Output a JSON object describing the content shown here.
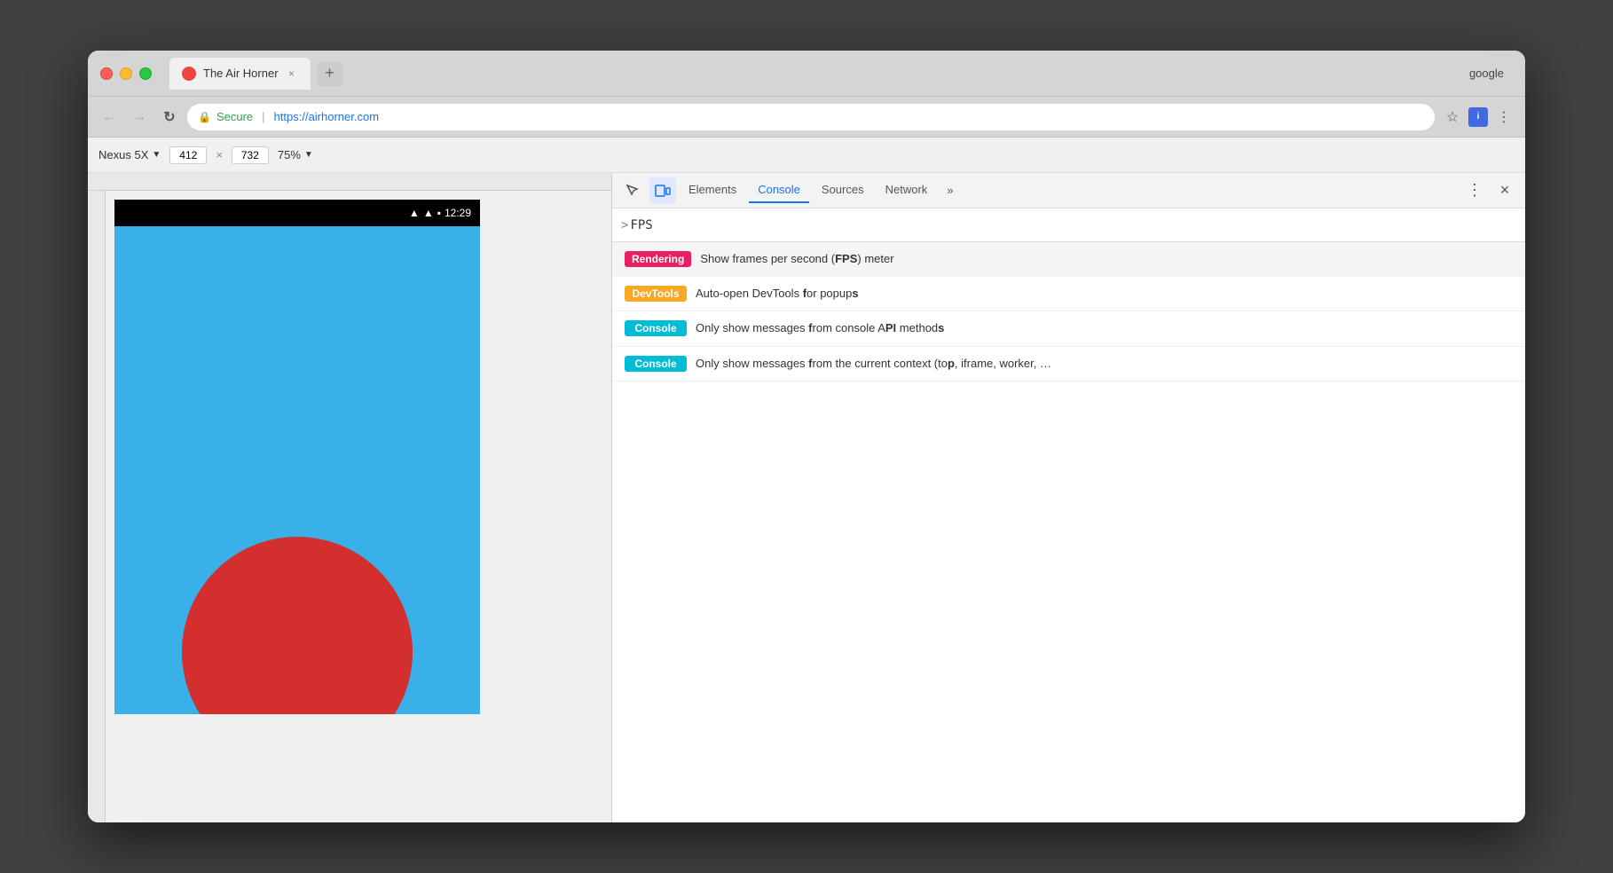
{
  "browser": {
    "traffic_lights": {
      "close": "close",
      "minimize": "minimize",
      "maximize": "maximize"
    },
    "tab": {
      "title": "The Air Horner",
      "favicon_color": "#cc3333"
    },
    "search_query": "google",
    "address": {
      "secure_label": "Secure",
      "url": "https://airhorner.com"
    }
  },
  "device_toolbar": {
    "device_name": "Nexus 5X",
    "width": "412",
    "height": "732",
    "zoom": "75%",
    "x_separator": "×"
  },
  "device_screen": {
    "time": "12:29",
    "bg_color": "#3ab0e8"
  },
  "devtools": {
    "tabs": [
      {
        "label": "Elements",
        "active": false
      },
      {
        "label": "Console",
        "active": true
      },
      {
        "label": "Sources",
        "active": false
      },
      {
        "label": "Network",
        "active": false
      }
    ],
    "more_tabs": "»",
    "console_prompt": ">",
    "console_query": "FPS",
    "suggestions": [
      {
        "badge_text": "Rendering",
        "badge_class": "badge-rendering",
        "text_html": "Show frames per second (<strong>FPS</strong>) meter",
        "text_plain": "Show frames per second (FPS) meter"
      },
      {
        "badge_text": "DevTools",
        "badge_class": "badge-devtools",
        "text_html": "Auto-open DevTools <strong>f</strong>or popup<strong>s</strong>",
        "text_plain": "Auto-open DevTools for popups"
      },
      {
        "badge_text": "Console",
        "badge_class": "badge-console",
        "text_html": "Only show messages <strong>f</strong>rom console A<strong>PI</strong> method<strong>s</strong>",
        "text_plain": "Only show messages from console API methods"
      },
      {
        "badge_text": "Console",
        "badge_class": "badge-console",
        "text_html": "Only show messages <strong>f</strong>rom the current context (to<strong>p</strong>, iframe, worker, …",
        "text_plain": "Only show messages from the current context (top, iframe, worker, …"
      }
    ]
  }
}
